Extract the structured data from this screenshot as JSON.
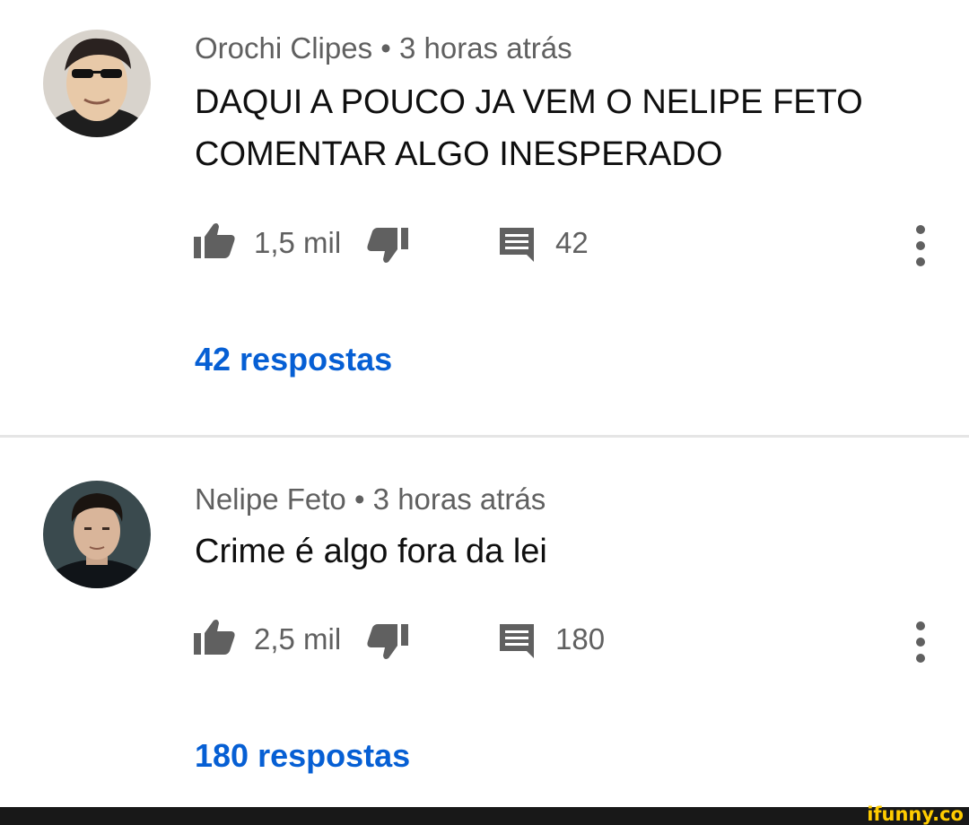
{
  "comments": [
    {
      "author": "Orochi Clipes",
      "time": "3 horas atrás",
      "separator": "•",
      "text": "DAQUI A POUCO JA VEM O NELIPE FETO COMENTAR ALGO INESPERADO",
      "likes": "1,5 mil",
      "reply_count": "42",
      "replies_link": "42 respostas"
    },
    {
      "author": "Nelipe Feto",
      "time": "3 horas atrás",
      "separator": "•",
      "text": "Crime é algo fora da lei",
      "likes": "2,5 mil",
      "reply_count": "180",
      "replies_link": "180 respostas"
    }
  ],
  "icons": {
    "like": "thumbs-up-icon",
    "dislike": "thumbs-down-icon",
    "reply": "reply-comment-icon",
    "more": "vertical-dots-menu-icon"
  },
  "colors": {
    "link_blue": "#065fd4",
    "meta_gray": "#606060",
    "icon_gray": "#606060",
    "watermark_yellow": "#ffcc00"
  },
  "watermark": "ifunny.co"
}
